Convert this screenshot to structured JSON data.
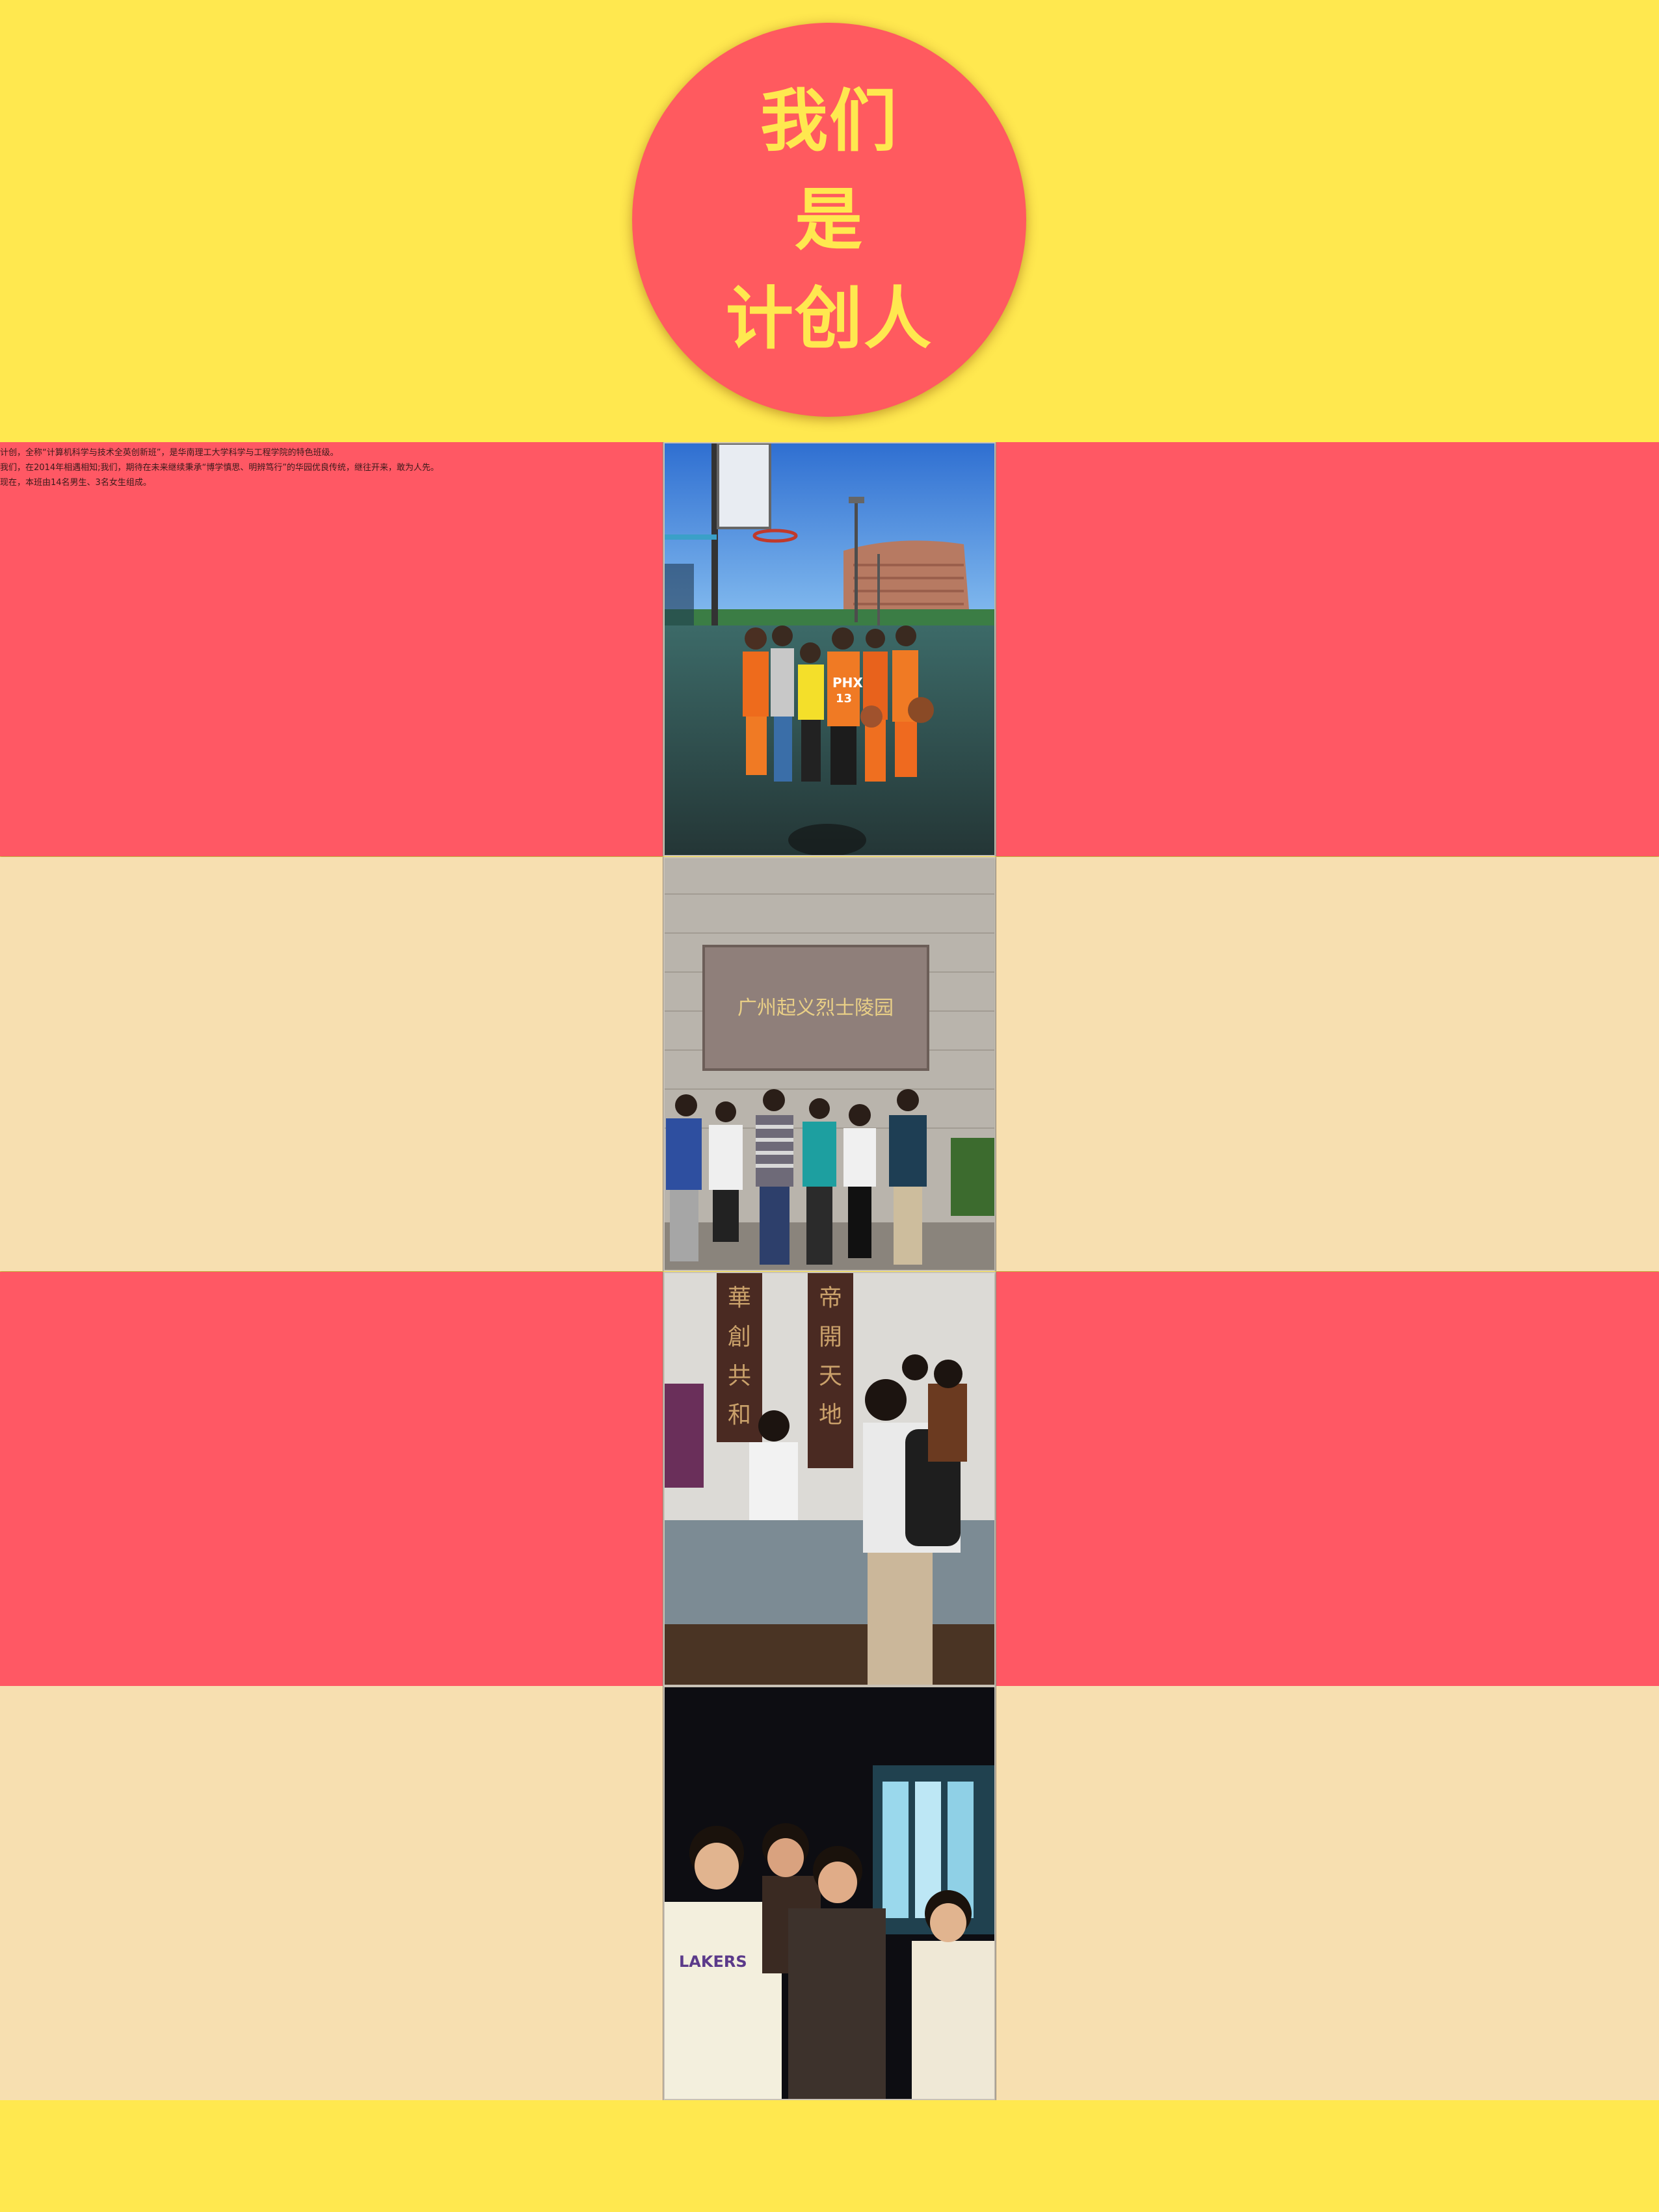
{
  "hero": {
    "line1": "我们",
    "line2": "是",
    "line3": "计创人"
  },
  "intro": {
    "line1": "计创，全称“计算机科学与技术全英创新班”，是华南理工大学科学与工程学院的特色班级。",
    "line2": "我们，在2014年相遇相知;我们，期待在未来继续秉承“博学慎思、明辨笃行”的华园优良传统，继往开来，敢为人先。",
    "line3": "现在，本班由14名男生、3名女生组成。"
  },
  "photos": [
    {
      "subject": "basketball-court-group",
      "scene_text": "PHX 13"
    },
    {
      "subject": "memorial-park-group",
      "scene_text": "广州起义烈士陵园"
    },
    {
      "subject": "museum-visit-group",
      "scene_text": "華創共和 帝開天地"
    },
    {
      "subject": "night-group",
      "scene_text": "LAKERS"
    }
  ],
  "colors": {
    "yellow": "#ffe84f",
    "red": "#ff5864",
    "circle": "#ff5a5f",
    "beige": "#f7dfb0"
  }
}
